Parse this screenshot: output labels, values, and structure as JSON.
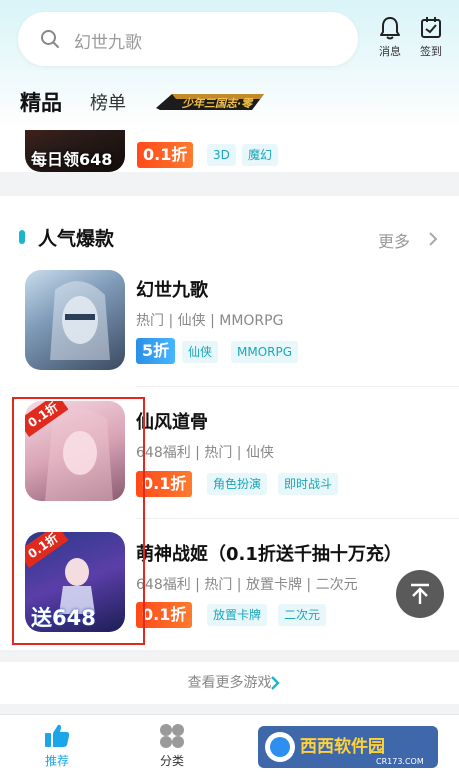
{
  "search": {
    "placeholder": "幻世九歌"
  },
  "header_buttons": {
    "messages_label": "消息",
    "checkin_label": "签到"
  },
  "tabs": {
    "featured": "精品",
    "ranking": "榜单"
  },
  "promo_banner": {
    "text": "少年三国志·零"
  },
  "top_game": {
    "icon_text": "每日领648",
    "discount": "0.1折",
    "tags": [
      "3D",
      "魔幻"
    ]
  },
  "section": {
    "title": "人气爆款",
    "more": "更多"
  },
  "games": [
    {
      "name": "幻世九歌",
      "meta": "热门 | 仙侠 | MMORPG",
      "discount": "5折",
      "tags": [
        "仙侠",
        "MMORPG"
      ]
    },
    {
      "name": "仙风道骨",
      "meta": "648福利 | 热门 | 仙侠",
      "discount": "0.1折",
      "tags": [
        "角色扮演",
        "即时战斗"
      ],
      "icon_badge": "0.1折"
    },
    {
      "name": "萌神战姬（0.1折送千抽十万充）",
      "meta": "648福利 | 热门 | 放置卡牌 | 二次元",
      "discount": "0.1折",
      "tags": [
        "放置卡牌",
        "二次元"
      ],
      "icon_badge": "0.1折",
      "icon_text": "送648"
    }
  ],
  "see_more": "查看更多游戏",
  "bottom_nav": [
    {
      "label": "推荐",
      "icon": "thumbs-up-icon",
      "active": true
    },
    {
      "label": "分类",
      "icon": "grid-icon",
      "active": false
    }
  ],
  "watermark": {
    "text": "西西软件园",
    "sub": "CR173.COM"
  },
  "colors": {
    "accent": "#1db5cc",
    "discount": "#ff4a1a",
    "highlight": "#e5271d",
    "active_nav": "#1aa6e8"
  }
}
